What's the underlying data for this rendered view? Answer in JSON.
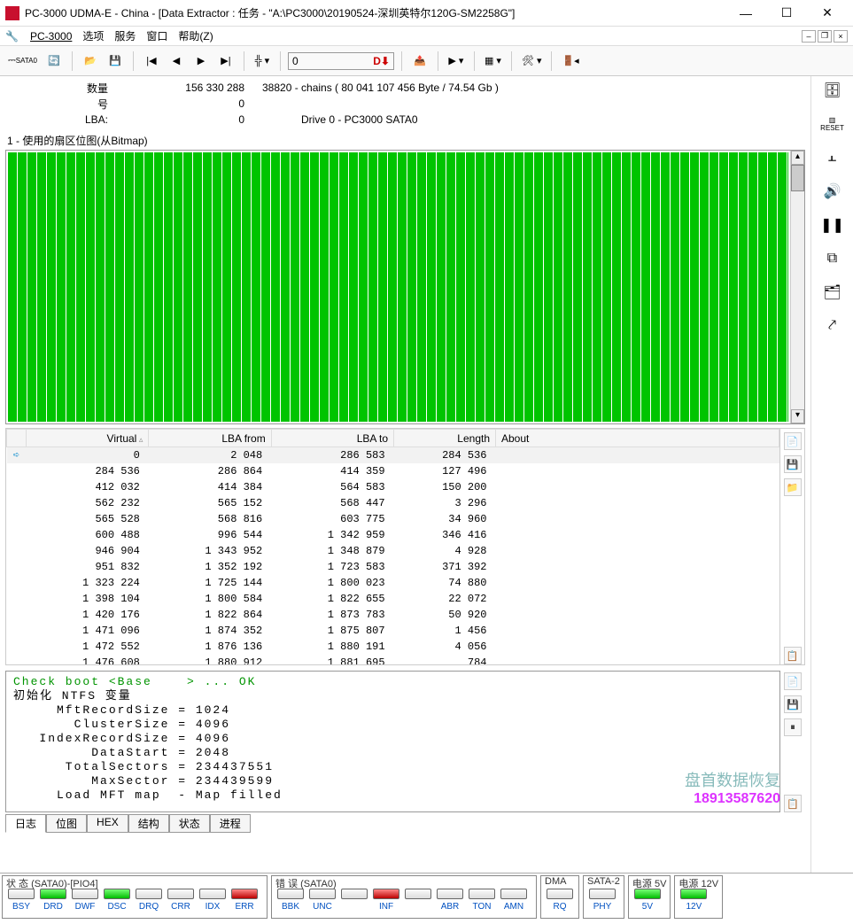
{
  "title": "PC-3000 UDMA-E - China - [Data Extractor : 任务 - \"A:\\PC3000\\20190524-深圳英特尔120G-SM2258G\"]",
  "menu": {
    "brand": "PC-3000",
    "items": [
      "选项",
      "服务",
      "窗口",
      "帮助(Z)"
    ]
  },
  "toolbar": {
    "sata": "SATA0",
    "input_val": "0",
    "input_badge": "D⬇"
  },
  "info": {
    "rows": [
      {
        "label": "数量",
        "val": "156 330 288",
        "extra": "38820 - chains   ( 80 041 107 456 Byte /   74.54 Gb )"
      },
      {
        "label": "号",
        "val": "0",
        "extra": ""
      },
      {
        "label": "LBA:",
        "val": "0",
        "extra": "Drive     0 - PC3000 SATA0"
      }
    ]
  },
  "bitmap_label": "1 - 使用的扇区位图(从Bitmap)",
  "table": {
    "headers": [
      "Virtual",
      "LBA from",
      "LBA to",
      "Length",
      "About"
    ],
    "rows": [
      [
        "0",
        "2 048",
        "286 583",
        "284 536"
      ],
      [
        "284 536",
        "286 864",
        "414 359",
        "127 496"
      ],
      [
        "412 032",
        "414 384",
        "564 583",
        "150 200"
      ],
      [
        "562 232",
        "565 152",
        "568 447",
        "3 296"
      ],
      [
        "565 528",
        "568 816",
        "603 775",
        "34 960"
      ],
      [
        "600 488",
        "996 544",
        "1 342 959",
        "346 416"
      ],
      [
        "946 904",
        "1 343 952",
        "1 348 879",
        "4 928"
      ],
      [
        "951 832",
        "1 352 192",
        "1 723 583",
        "371 392"
      ],
      [
        "1 323 224",
        "1 725 144",
        "1 800 023",
        "74 880"
      ],
      [
        "1 398 104",
        "1 800 584",
        "1 822 655",
        "22 072"
      ],
      [
        "1 420 176",
        "1 822 864",
        "1 873 783",
        "50 920"
      ],
      [
        "1 471 096",
        "1 874 352",
        "1 875 807",
        "1 456"
      ],
      [
        "1 472 552",
        "1 876 136",
        "1 880 191",
        "4 056"
      ],
      [
        "1 476 608",
        "1 880 912",
        "1 881 695",
        "784"
      ]
    ]
  },
  "log": {
    "lines": [
      {
        "c": "g",
        "t": "Check boot <Base    > ... OK"
      },
      {
        "c": "b",
        "t": "初始化 NTFS 变量"
      },
      {
        "c": "b",
        "t": "     MftRecordSize = 1024"
      },
      {
        "c": "b",
        "t": "       ClusterSize = 4096"
      },
      {
        "c": "b",
        "t": "   IndexRecordSize = 4096"
      },
      {
        "c": "b",
        "t": "         DataStart = 2048"
      },
      {
        "c": "b",
        "t": "      TotalSectors = 234437551"
      },
      {
        "c": "b",
        "t": "         MaxSector = 234439599"
      },
      {
        "c": "b",
        "t": "     Load MFT map  - Map filled"
      }
    ]
  },
  "tabs": [
    "日志",
    "位图",
    "HEX",
    "结构",
    "状态",
    "进程"
  ],
  "status": {
    "group1_title": "状 态 (SATA0)-[PIO4]",
    "group1": [
      {
        "lbl": "BSY",
        "c": "off"
      },
      {
        "lbl": "DRD",
        "c": "green"
      },
      {
        "lbl": "DWF",
        "c": "off"
      },
      {
        "lbl": "DSC",
        "c": "green"
      },
      {
        "lbl": "DRQ",
        "c": "off"
      },
      {
        "lbl": "CRR",
        "c": "off"
      },
      {
        "lbl": "IDX",
        "c": "off"
      },
      {
        "lbl": "ERR",
        "c": "red"
      }
    ],
    "group2_title": "错 误 (SATA0)",
    "group2": [
      {
        "lbl": "BBK",
        "c": "off"
      },
      {
        "lbl": "UNC",
        "c": "off"
      },
      {
        "lbl": "",
        "c": "off"
      },
      {
        "lbl": "INF",
        "c": "red"
      },
      {
        "lbl": "",
        "c": "off"
      },
      {
        "lbl": "ABR",
        "c": "off"
      },
      {
        "lbl": "TON",
        "c": "off"
      },
      {
        "lbl": "AMN",
        "c": "off"
      }
    ],
    "group3_title": "DMA",
    "group3": [
      {
        "lbl": "RQ",
        "c": "off"
      }
    ],
    "group4_title": "SATA-2",
    "group4": [
      {
        "lbl": "PHY",
        "c": "off"
      }
    ],
    "group5_title": "电源 5V",
    "group5": [
      {
        "lbl": "5V",
        "c": "green"
      }
    ],
    "group6_title": "电源 12V",
    "group6": [
      {
        "lbl": "12V",
        "c": "green"
      }
    ]
  },
  "watermark": {
    "l1": "盘首数据恢复",
    "l2": "18913587620"
  }
}
